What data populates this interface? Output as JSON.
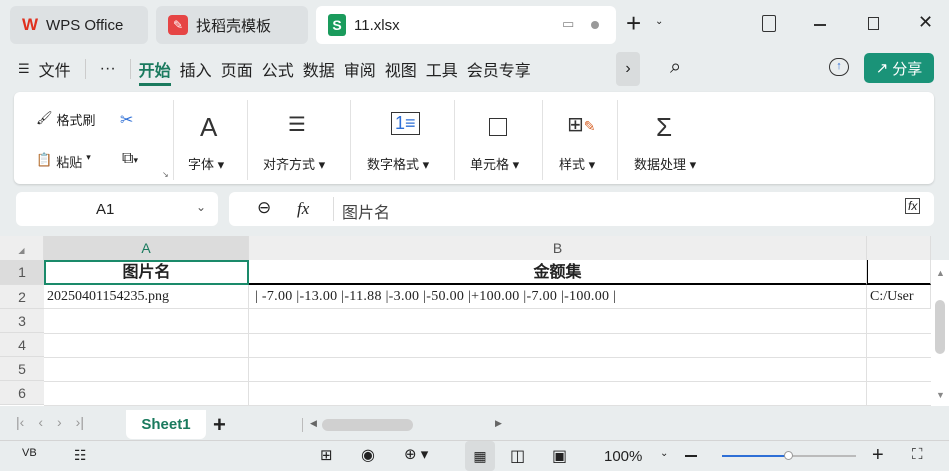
{
  "tabs": [
    {
      "label": "WPS Office",
      "icon": "wps-logo-icon"
    },
    {
      "label": "找稻壳模板",
      "icon": "docer-icon"
    },
    {
      "label": "11.xlsx",
      "icon": "spreadsheet-icon"
    }
  ],
  "menu": {
    "file": "文件",
    "more": "···",
    "items": [
      "开始",
      "插入",
      "页面",
      "公式",
      "数据",
      "审阅",
      "视图",
      "工具",
      "会员专享"
    ],
    "active": "开始",
    "share": "分享"
  },
  "ribbon": {
    "format_painter": "格式刷",
    "paste": "粘贴",
    "font": "字体",
    "align": "对齐方式",
    "number_format": "数字格式",
    "cell": "单元格",
    "style": "样式",
    "data_processing": "数据处理"
  },
  "formula_bar": {
    "name_box": "A1",
    "fx": "fx",
    "content": "图片名"
  },
  "sheet": {
    "columns": [
      "A",
      "B"
    ],
    "rows": [
      "1",
      "2",
      "3",
      "4",
      "5",
      "6"
    ],
    "cells": {
      "A1": "图片名",
      "B1": "金额集",
      "A2": "20250401154235.png",
      "B2": "| -7.00 |-13.00 |-11.88 |-3.00 |-50.00 |+100.00 |-7.00 |-100.00 |",
      "C2": "C:/User"
    }
  },
  "sheet_tabs": {
    "active": "Sheet1"
  },
  "status": {
    "zoom": "100%",
    "zoom_level": 0.5
  },
  "colors": {
    "accent": "#1a8a6a",
    "share_bg": "#1a9378",
    "zoom_slider": "#2e6fd6"
  }
}
